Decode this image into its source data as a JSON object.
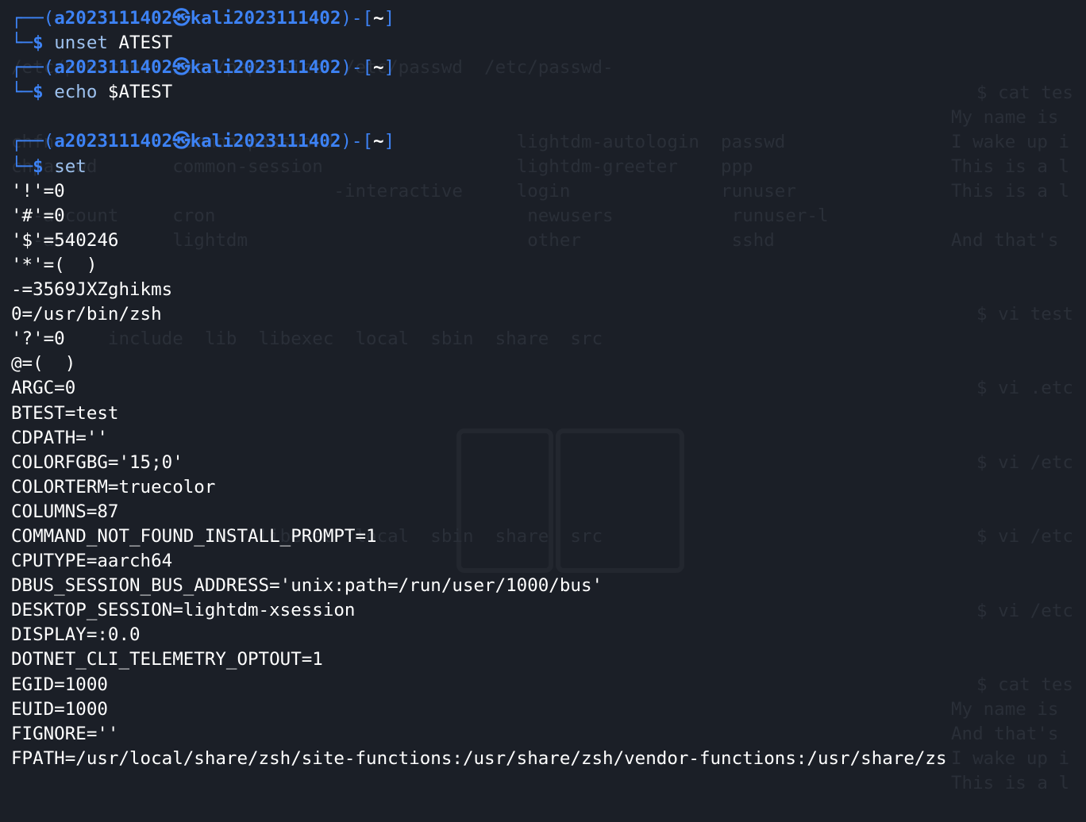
{
  "prompts": [
    {
      "user": "a2023111402",
      "host": "kali2023111402",
      "cwd": "~",
      "command": "unset",
      "args": " ATEST"
    },
    {
      "user": "a2023111402",
      "host": "kali2023111402",
      "cwd": "~",
      "command": "echo",
      "args": " $ATEST"
    },
    {
      "user": "a2023111402",
      "host": "kali2023111402",
      "cwd": "~",
      "command": "set",
      "args": ""
    }
  ],
  "set_output": [
    "'!'=0",
    "'#'=0",
    "'$'=540246",
    "'*'=(  )",
    "-=3569JXZghikms",
    "0=/usr/bin/zsh",
    "'?'=0",
    "@=(  )",
    "ARGC=0",
    "BTEST=test",
    "CDPATH=''",
    "COLORFGBG='15;0'",
    "COLORTERM=truecolor",
    "COLUMNS=87",
    "COMMAND_NOT_FOUND_INSTALL_PROMPT=1",
    "CPUTYPE=aarch64",
    "DBUS_SESSION_BUS_ADDRESS='unix:path=/run/user/1000/bus'",
    "DESKTOP_SESSION=lightdm-xsession",
    "DISPLAY=:0.0",
    "DOTNET_CLI_TELEMETRY_OPTOUT=1",
    "EGID=1000",
    "EUID=1000",
    "FIGNORE=''",
    "FPATH=/usr/local/share/zsh/site-functions:/usr/share/zsh/vendor-functions:/usr/share/zs"
  ],
  "ghost_text": {
    "g1": "/etc/pam.conf  /etc/papersize  /etc/passwd  /etc/passwd-",
    "g2": "chfn           common-password                 lightdm-autologin  passwd",
    "g3": "chpasswd       common-session                  lightdm-greeter    ppp",
    "g4": "                              -interactive     login              runuser",
    "g5": "  -account     cron                             newusers           runuser-l",
    "g6": "  -auth        lightdm                          other              sshd",
    "g7": "         include  lib  libexec  local  sbin  share  src",
    "g8": "                  lib  libexec  local  sbin  share  src",
    "r1": "My name is",
    "r2": "I wake up i",
    "r3": "This is a l",
    "r4": "This is a l",
    "r5": "And that's",
    "r6": "$ cat tes",
    "r7": "$ vi test",
    "r8": "$ vi .etc",
    "r9": "$ vi /etc",
    "r10": "$ vi /etc",
    "r11": "$ vi /etc",
    "r12": "$ cat tes",
    "r13": "My name is",
    "r14": "And that's",
    "r15": "I wake up i",
    "r16": "This is a l"
  },
  "colors": {
    "background": "#1b1f27",
    "prompt_frame": "#3d82f4",
    "command": "#9dc1ee",
    "text": "#ffffff",
    "ghost": "#2a2f38"
  }
}
